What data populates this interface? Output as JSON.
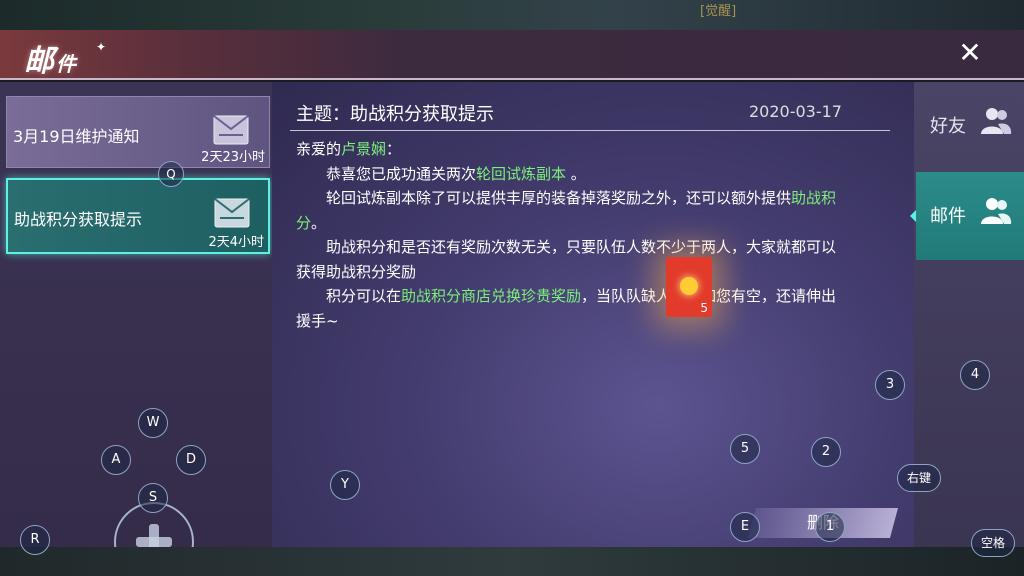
{
  "scene": {
    "ghost_text": "...(ghost partial text)",
    "ghost_tag": "[觉醒]"
  },
  "header": {
    "title_main": "邮",
    "title_sub": "件",
    "close_label": "✕"
  },
  "mail_list": [
    {
      "subject": "3月19日维护通知",
      "expires": "2天23小时",
      "selected": false
    },
    {
      "subject": "助战积分获取提示",
      "expires": "2天4小时",
      "selected": true
    }
  ],
  "mail_detail": {
    "subject_label": "主题：助战积分获取提示",
    "date": "2020-03-17",
    "greeting_prefix": "亲爱的",
    "recipient_name": "卢景娴",
    "greeting_suffix": "：",
    "line1_prefix": "恭喜您已成功通关两次",
    "line1_highlight": "轮回试炼副本",
    "line1_suffix": " 。",
    "line2_prefix": "轮回试炼副本除了可以提供丰厚的装备掉落奖励之外，还可以额外提供",
    "line2_highlight": "助战积分",
    "line2_suffix": "。",
    "line3": "助战积分和是否还有奖励次数无关，只要队伍人数不少于两人，大家就都可以获得助战积分奖励",
    "line4_prefix": "积分可以在",
    "line4_highlight": "助战积分商店兑换珍贵奖励",
    "line4_mid": "，当队",
    "line4_suffix": "队缺人时，如您有空，还请伸出援手~",
    "delete_label": "删除",
    "red_packet_count": "5"
  },
  "tabs": [
    {
      "label": "好友",
      "icon": "friends-icon",
      "active": false
    },
    {
      "label": "邮件",
      "icon": "friends-icon",
      "active": true
    }
  ],
  "key_hints": {
    "q": "Q",
    "w": "W",
    "a": "A",
    "s": "S",
    "d": "D",
    "y": "Y",
    "r": "R",
    "e": "E",
    "k1": "1",
    "k2": "2",
    "k3": "3",
    "k4": "4",
    "k5": "5",
    "right_key": "右键",
    "space": "空格"
  },
  "colors": {
    "accent_teal": "#5cf2e2",
    "highlight_green": "#7cf07a"
  }
}
